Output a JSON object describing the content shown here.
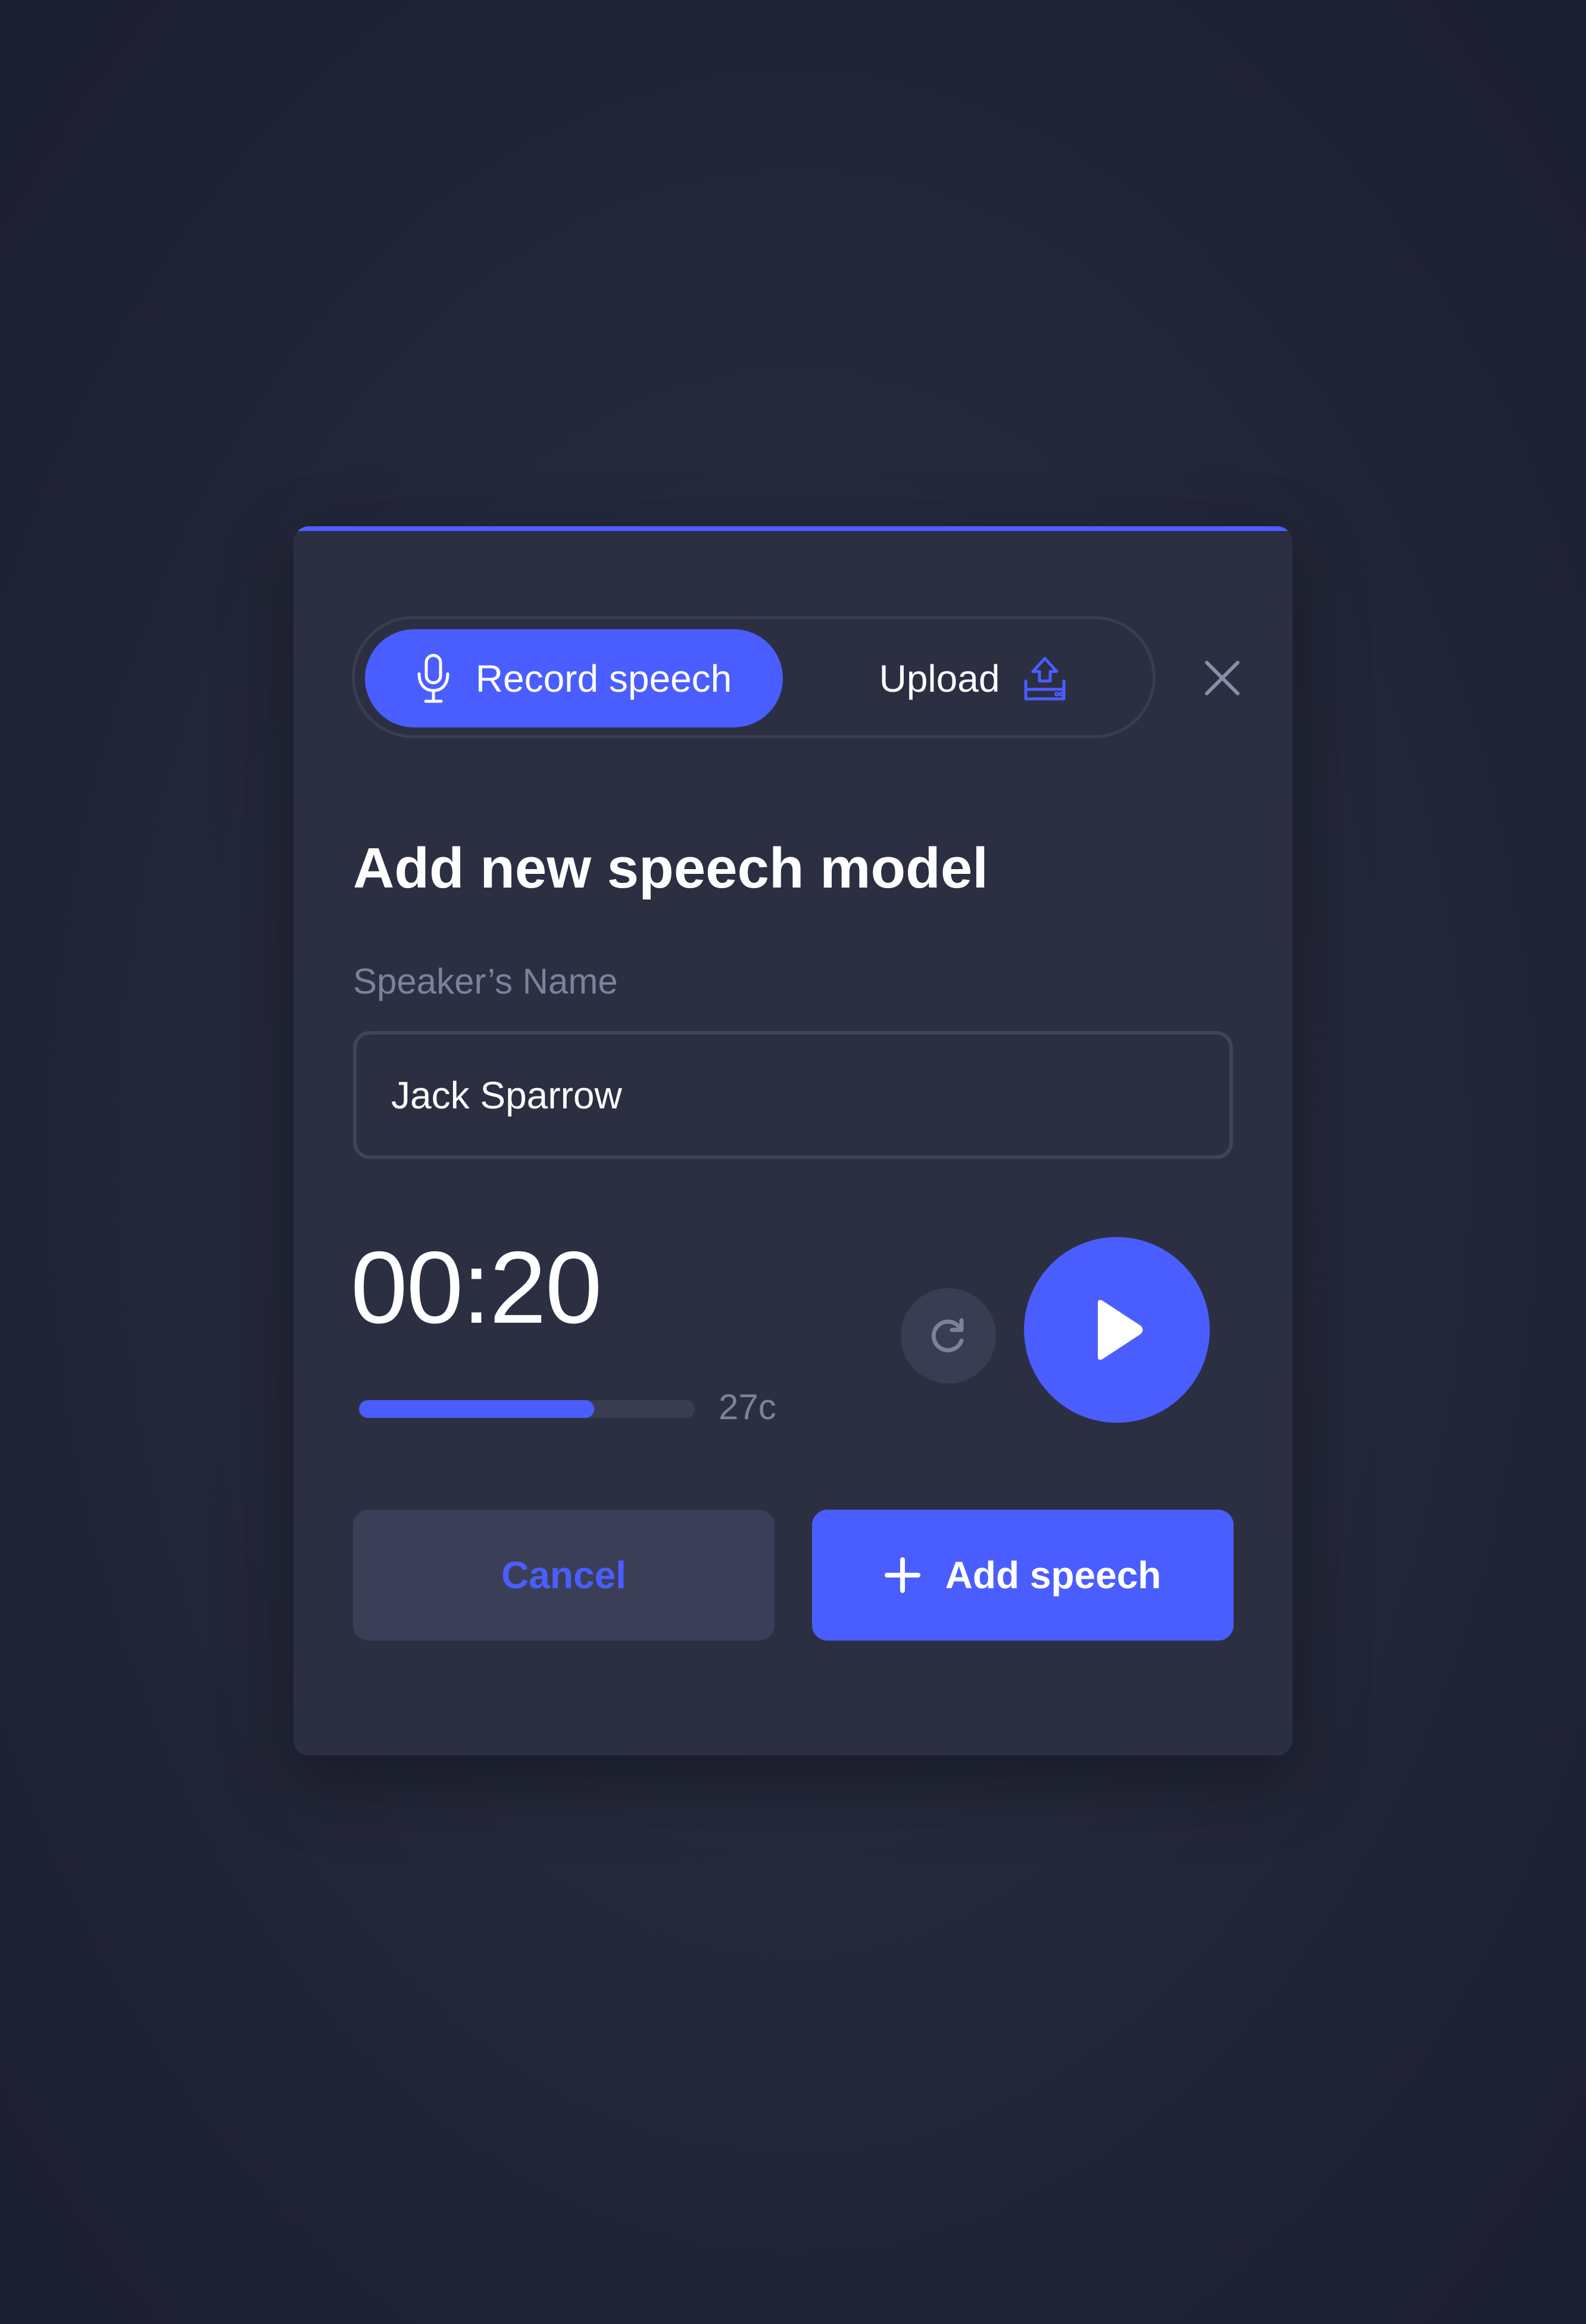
{
  "colors": {
    "accent": "#4a5eff",
    "dialog_bg": "#2c2f42",
    "muted_text": "#7d8199"
  },
  "tabs": {
    "record": {
      "label": "Record speech",
      "icon": "microphone-icon",
      "active": true
    },
    "upload": {
      "label": "Upload",
      "icon": "upload-icon",
      "active": false
    }
  },
  "close": {
    "icon": "close-icon"
  },
  "title": "Add new speech model",
  "speaker_field": {
    "label": "Speaker’s Name",
    "value": "Jack Sparrow"
  },
  "recording": {
    "timer": "00:20",
    "progress_fraction": 0.7,
    "progress_label": "27c",
    "reset_icon": "redo-icon",
    "play_icon": "play-icon"
  },
  "actions": {
    "cancel_label": "Cancel",
    "add_label": "Add speech",
    "add_icon": "plus-icon"
  }
}
